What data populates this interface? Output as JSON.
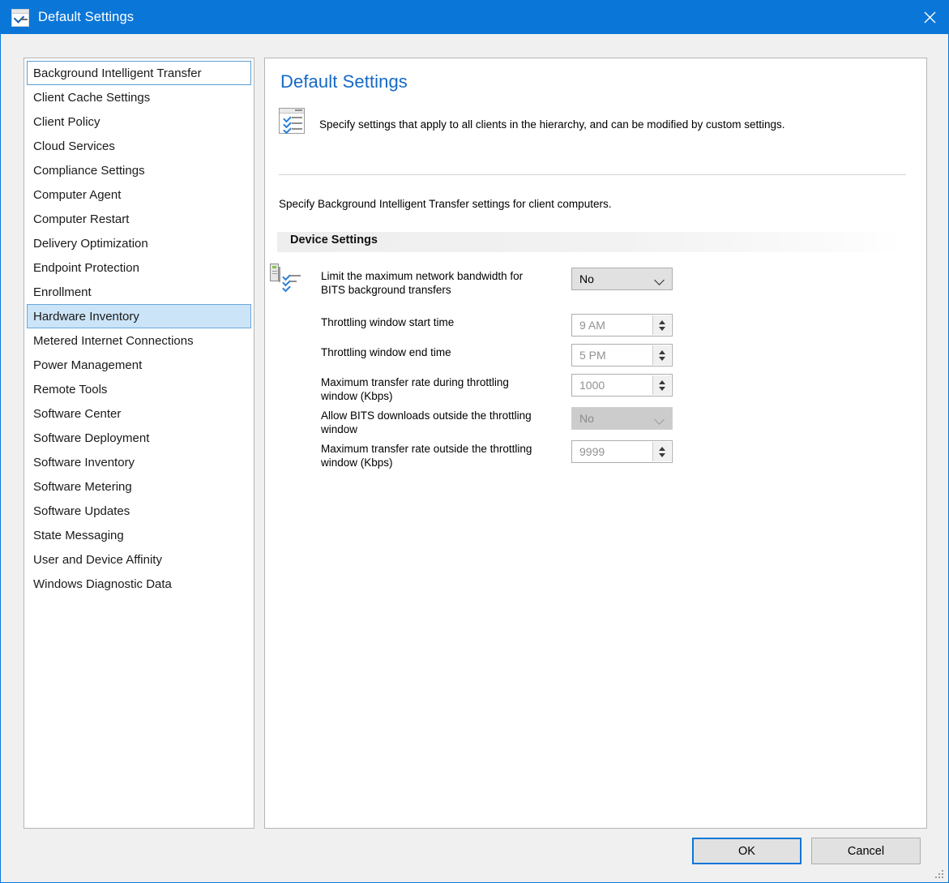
{
  "window": {
    "title": "Default Settings",
    "title_icon": "checklist-window-icon",
    "close_icon": "close-icon",
    "accent_color": "#0a76d8",
    "background_color": "#f0f0f0"
  },
  "sidebar": {
    "items": [
      {
        "label": "Background Intelligent Transfer",
        "state": "focused"
      },
      {
        "label": "Client Cache Settings",
        "state": "normal"
      },
      {
        "label": "Client Policy",
        "state": "normal"
      },
      {
        "label": "Cloud Services",
        "state": "normal"
      },
      {
        "label": "Compliance Settings",
        "state": "normal"
      },
      {
        "label": "Computer Agent",
        "state": "normal"
      },
      {
        "label": "Computer Restart",
        "state": "normal"
      },
      {
        "label": "Delivery Optimization",
        "state": "normal"
      },
      {
        "label": "Endpoint Protection",
        "state": "normal"
      },
      {
        "label": "Enrollment",
        "state": "normal"
      },
      {
        "label": "Hardware Inventory",
        "state": "selected"
      },
      {
        "label": "Metered Internet Connections",
        "state": "normal"
      },
      {
        "label": "Power Management",
        "state": "normal"
      },
      {
        "label": "Remote Tools",
        "state": "normal"
      },
      {
        "label": "Software Center",
        "state": "normal"
      },
      {
        "label": "Software Deployment",
        "state": "normal"
      },
      {
        "label": "Software Inventory",
        "state": "normal"
      },
      {
        "label": "Software Metering",
        "state": "normal"
      },
      {
        "label": "Software Updates",
        "state": "normal"
      },
      {
        "label": "State Messaging",
        "state": "normal"
      },
      {
        "label": "User and Device Affinity",
        "state": "normal"
      },
      {
        "label": "Windows Diagnostic Data",
        "state": "normal"
      }
    ]
  },
  "panel": {
    "title": "Default Settings",
    "title_color": "#1569c7",
    "header_icon": "checklist-document-icon",
    "header_text": "Specify settings that apply to all clients in the hierarchy, and can be modified by custom settings.",
    "description": "Specify Background Intelligent Transfer settings for client computers.",
    "group": {
      "title": "Device Settings",
      "row_icon": "checklist-computer-icon",
      "rows": [
        {
          "label": "Limit the maximum network bandwidth for BITS background transfers",
          "control": "combobox",
          "value": "No",
          "disabled": false,
          "has_icon": true
        },
        {
          "label": "Throttling window start time",
          "control": "spinner",
          "value": "9 AM",
          "disabled": true,
          "has_icon": false
        },
        {
          "label": "Throttling window end time",
          "control": "spinner",
          "value": "5 PM",
          "disabled": true,
          "has_icon": false
        },
        {
          "label": "Maximum transfer rate during throttling window (Kbps)",
          "control": "spinner",
          "value": "1000",
          "disabled": true,
          "has_icon": false
        },
        {
          "label": "Allow BITS downloads outside the throttling window",
          "control": "combobox",
          "value": "No",
          "disabled": true,
          "has_icon": false
        },
        {
          "label": "Maximum transfer rate outside the throttling window (Kbps)",
          "control": "spinner",
          "value": "9999",
          "disabled": true,
          "has_icon": false
        }
      ]
    }
  },
  "footer": {
    "ok_label": "OK",
    "cancel_label": "Cancel",
    "resize_grip": "resize-grip-icon"
  }
}
